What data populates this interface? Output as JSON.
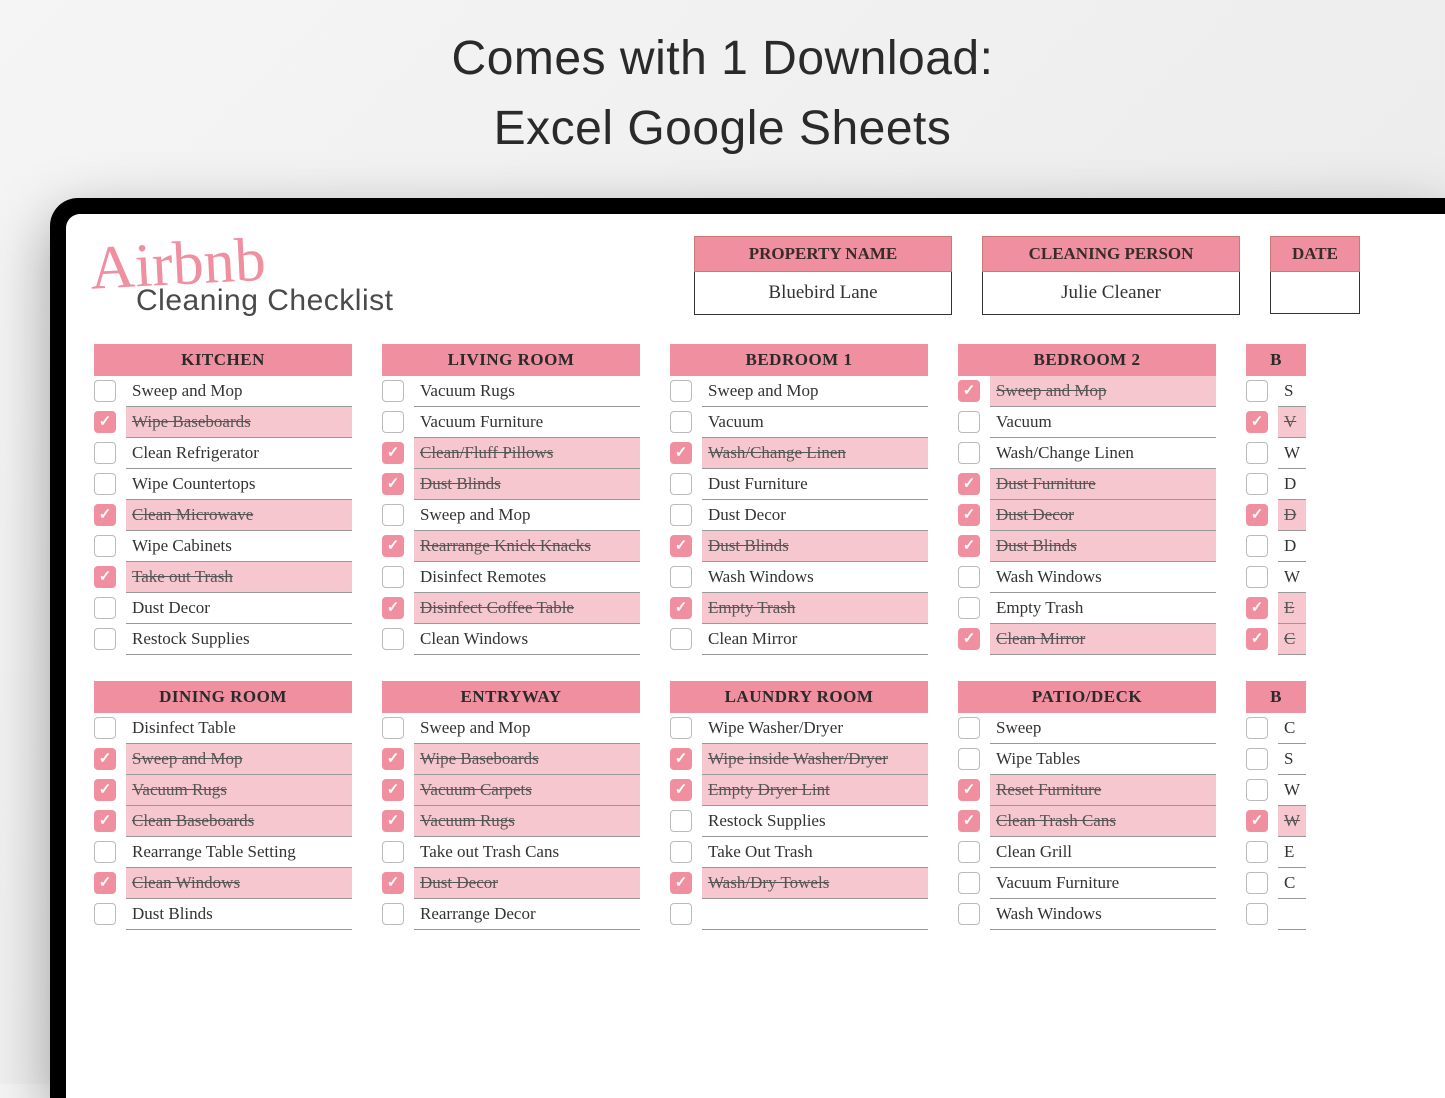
{
  "headline": {
    "line1": "Comes with 1 Download:",
    "line2": "Excel Google Sheets"
  },
  "brand": {
    "script": "Airbnb",
    "sub": "Cleaning Checklist"
  },
  "info": {
    "property": {
      "header": "PROPERTY NAME",
      "value": "Bluebird Lane"
    },
    "cleaner": {
      "header": "CLEANING PERSON",
      "value": "Julie Cleaner"
    },
    "date": {
      "header": "DATE",
      "value": ""
    }
  },
  "columns": [
    {
      "sections": [
        {
          "title": "KITCHEN",
          "items": [
            {
              "label": "Sweep and Mop",
              "done": false
            },
            {
              "label": "Wipe Baseboards",
              "done": true
            },
            {
              "label": "Clean Refrigerator",
              "done": false
            },
            {
              "label": "Wipe Countertops",
              "done": false
            },
            {
              "label": "Clean Microwave",
              "done": true
            },
            {
              "label": "Wipe Cabinets",
              "done": false
            },
            {
              "label": "Take out Trash",
              "done": true
            },
            {
              "label": "Dust Decor",
              "done": false
            },
            {
              "label": "Restock Supplies",
              "done": false
            }
          ]
        },
        {
          "title": "DINING ROOM",
          "items": [
            {
              "label": "Disinfect Table",
              "done": false
            },
            {
              "label": "Sweep and Mop",
              "done": true
            },
            {
              "label": "Vacuum Rugs",
              "done": true
            },
            {
              "label": "Clean Baseboards",
              "done": true
            },
            {
              "label": "Rearrange Table Setting",
              "done": false
            },
            {
              "label": "Clean Windows",
              "done": true
            },
            {
              "label": "Dust Blinds",
              "done": false
            }
          ]
        }
      ]
    },
    {
      "sections": [
        {
          "title": "LIVING ROOM",
          "items": [
            {
              "label": "Vacuum Rugs",
              "done": false
            },
            {
              "label": "Vacuum Furniture",
              "done": false
            },
            {
              "label": "Clean/Fluff Pillows",
              "done": true
            },
            {
              "label": "Dust Blinds",
              "done": true
            },
            {
              "label": "Sweep and Mop",
              "done": false
            },
            {
              "label": "Rearrange Knick Knacks",
              "done": true
            },
            {
              "label": "Disinfect Remotes",
              "done": false
            },
            {
              "label": "Disinfect Coffee Table",
              "done": true
            },
            {
              "label": "Clean Windows",
              "done": false
            }
          ]
        },
        {
          "title": "ENTRYWAY",
          "items": [
            {
              "label": "Sweep and Mop",
              "done": false
            },
            {
              "label": "Wipe Baseboards",
              "done": true
            },
            {
              "label": "Vacuum Carpets",
              "done": true
            },
            {
              "label": "Vacuum Rugs",
              "done": true
            },
            {
              "label": "Take out Trash Cans",
              "done": false
            },
            {
              "label": "Dust Decor",
              "done": true
            },
            {
              "label": "Rearrange Decor",
              "done": false
            }
          ]
        }
      ]
    },
    {
      "sections": [
        {
          "title": "BEDROOM 1",
          "items": [
            {
              "label": "Sweep and Mop",
              "done": false
            },
            {
              "label": "Vacuum",
              "done": false
            },
            {
              "label": "Wash/Change Linen",
              "done": true
            },
            {
              "label": "Dust Furniture",
              "done": false
            },
            {
              "label": "Dust Decor",
              "done": false
            },
            {
              "label": "Dust Blinds",
              "done": true
            },
            {
              "label": "Wash Windows",
              "done": false
            },
            {
              "label": "Empty Trash",
              "done": true
            },
            {
              "label": "Clean Mirror",
              "done": false
            }
          ]
        },
        {
          "title": "LAUNDRY ROOM",
          "items": [
            {
              "label": "Wipe Washer/Dryer",
              "done": false
            },
            {
              "label": "Wipe inside Washer/Dryer",
              "done": true
            },
            {
              "label": "Empty Dryer Lint",
              "done": true
            },
            {
              "label": "Restock Supplies",
              "done": false
            },
            {
              "label": "Take Out Trash",
              "done": false
            },
            {
              "label": "Wash/Dry Towels",
              "done": true
            },
            {
              "label": "",
              "done": false
            }
          ]
        }
      ]
    },
    {
      "sections": [
        {
          "title": "BEDROOM 2",
          "items": [
            {
              "label": "Sweep and Mop",
              "done": true
            },
            {
              "label": "Vacuum",
              "done": false
            },
            {
              "label": "Wash/Change Linen",
              "done": false
            },
            {
              "label": "Dust Furniture",
              "done": true
            },
            {
              "label": "Dust Decor",
              "done": true
            },
            {
              "label": "Dust Blinds",
              "done": true
            },
            {
              "label": "Wash Windows",
              "done": false
            },
            {
              "label": "Empty Trash",
              "done": false
            },
            {
              "label": "Clean Mirror",
              "done": true
            }
          ]
        },
        {
          "title": "PATIO/DECK",
          "items": [
            {
              "label": "Sweep",
              "done": false
            },
            {
              "label": "Wipe Tables",
              "done": false
            },
            {
              "label": "Reset Furniture",
              "done": true
            },
            {
              "label": "Clean Trash Cans",
              "done": true
            },
            {
              "label": "Clean Grill",
              "done": false
            },
            {
              "label": "Vacuum Furniture",
              "done": false
            },
            {
              "label": "Wash Windows",
              "done": false
            }
          ]
        }
      ]
    },
    {
      "partial": true,
      "sections": [
        {
          "title": "B",
          "items": [
            {
              "label": "S",
              "done": false
            },
            {
              "label": "V",
              "done": true
            },
            {
              "label": "W",
              "done": false
            },
            {
              "label": "D",
              "done": false
            },
            {
              "label": "D",
              "done": true
            },
            {
              "label": "D",
              "done": false
            },
            {
              "label": "W",
              "done": false
            },
            {
              "label": "E",
              "done": true
            },
            {
              "label": "C",
              "done": true
            }
          ]
        },
        {
          "title": "B",
          "items": [
            {
              "label": "C",
              "done": false
            },
            {
              "label": "S",
              "done": false
            },
            {
              "label": "W",
              "done": false
            },
            {
              "label": "W",
              "done": true
            },
            {
              "label": "E",
              "done": false
            },
            {
              "label": "C",
              "done": false
            },
            {
              "label": "",
              "done": false
            }
          ]
        }
      ]
    }
  ]
}
